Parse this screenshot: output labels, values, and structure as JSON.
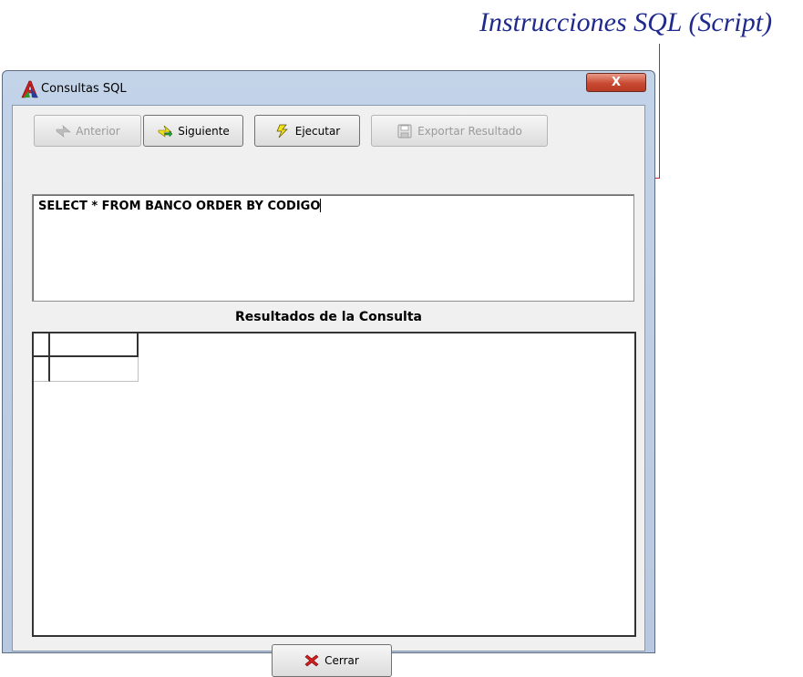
{
  "annotation": {
    "text": "Instrucciones SQL (Script)"
  },
  "window": {
    "title": "Consultas SQL",
    "close_label": "X"
  },
  "toolbar": {
    "anterior": {
      "label": "Anterior",
      "enabled": false
    },
    "siguiente": {
      "label": "Siguiente",
      "enabled": true
    },
    "ejecutar": {
      "label": "Ejecutar",
      "enabled": true
    },
    "exportar": {
      "label": "Exportar Resultado",
      "enabled": false
    }
  },
  "editor": {
    "sql": "SELECT * FROM BANCO ORDER BY CODIGO"
  },
  "results": {
    "label": "Resultados de la Consulta"
  },
  "footer": {
    "cerrar_label": "Cerrar"
  },
  "colors": {
    "annotation": "#1f2a8c",
    "arrow": "#d02020",
    "close_button": "#c94a32"
  }
}
